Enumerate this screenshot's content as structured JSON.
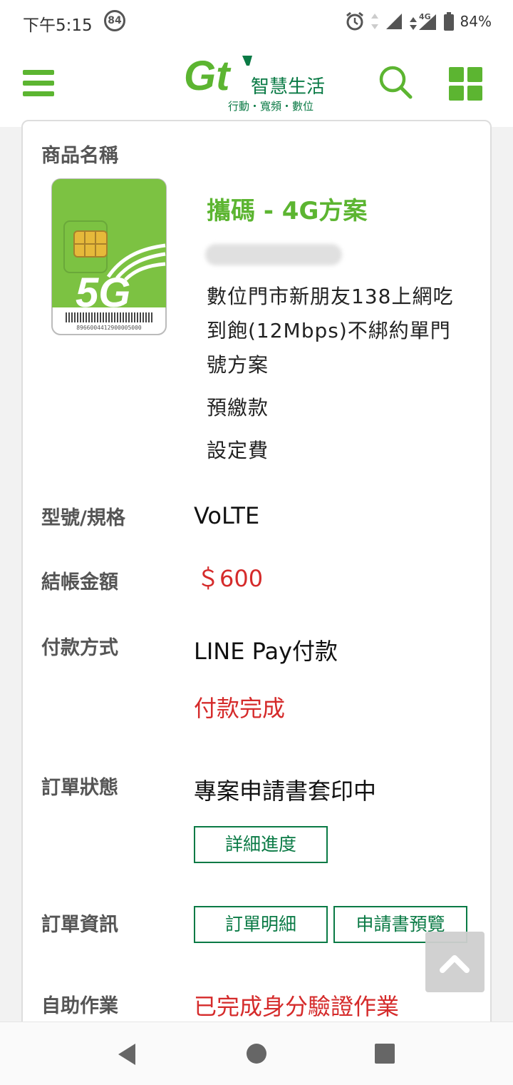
{
  "status_bar": {
    "time": "下午5:15",
    "notification_count": "84",
    "network": "4G",
    "battery": "84%"
  },
  "header": {
    "brand_logo": "Gt",
    "brand_name": "智慧生活",
    "brand_tagline": "行動・寬頻・數位"
  },
  "order": {
    "product_label": "商品名稱",
    "sim_card": {
      "badge": "5G",
      "barcode_number": "8966004412900005000"
    },
    "product_title": "攜碼 - 4G方案",
    "product_description": "數位門市新朋友138上網吃到飽(12Mbps)不綁約單門號方案",
    "prepaid": "預繳款",
    "setup_fee": "設定費",
    "model_label": "型號/規格",
    "model_value": "VoLTE",
    "amount_label": "結帳金額",
    "amount_value": "＄600",
    "payment_label": "付款方式",
    "payment_method": "LINE Pay付款",
    "payment_status": "付款完成",
    "status_label": "訂單狀態",
    "status_value": "專案申請書套印中",
    "progress_button": "詳細進度",
    "info_label": "訂單資訊",
    "order_detail_button": "訂單明細",
    "preview_button": "申請書預覽",
    "self_service_label": "自助作業",
    "self_service_value": "已完成身分驗證作業"
  },
  "colors": {
    "brand_green": "#5cb531",
    "button_green": "#0a7a45",
    "alert_red": "#d52b2b"
  }
}
